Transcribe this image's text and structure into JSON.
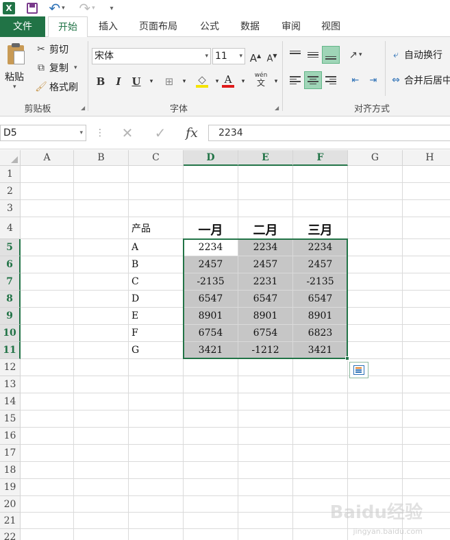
{
  "titlebar": {
    "logo": "X"
  },
  "tabs": [
    {
      "label": "文件",
      "active": false,
      "file": true
    },
    {
      "label": "开始",
      "active": true
    },
    {
      "label": "插入"
    },
    {
      "label": "页面布局"
    },
    {
      "label": "公式"
    },
    {
      "label": "数据"
    },
    {
      "label": "审阅"
    },
    {
      "label": "视图"
    }
  ],
  "ribbon": {
    "clipboard": {
      "paste_label": "粘贴",
      "cut_label": "剪切",
      "copy_label": "复制",
      "format_painter_label": "格式刷",
      "group_label": "剪贴板"
    },
    "font": {
      "font_name": "宋体",
      "font_size": "11",
      "grow_label": "A",
      "shrink_label": "A",
      "bold_label": "B",
      "italic_label": "I",
      "underline_label": "U",
      "font_color_label": "A",
      "phonetic_top": "wén",
      "phonetic_bottom": "文",
      "group_label": "字体"
    },
    "alignment": {
      "wrap_label": "自动换行",
      "merge_label": "合并后居中",
      "group_label": "对齐方式"
    },
    "colors": {
      "accent": "#217346",
      "font_color_bar": "#e01a1a",
      "fill_color_bar": "#f5e400",
      "selected_align_bg": "#9fd5b7"
    }
  },
  "formula_bar": {
    "name_box": "D5",
    "cancel_icon": "✕",
    "enter_icon": "✓",
    "fx_label": "fx",
    "value": "2234"
  },
  "sheet": {
    "columns": [
      "A",
      "B",
      "C",
      "D",
      "E",
      "F",
      "G",
      "H"
    ],
    "rows": [
      "1",
      "2",
      "3",
      "4",
      "5",
      "6",
      "7",
      "8",
      "9",
      "10",
      "11",
      "12",
      "13",
      "14",
      "15",
      "16",
      "17",
      "18",
      "19",
      "20",
      "21",
      "22"
    ],
    "header_row": {
      "c": "产品",
      "d": "一月",
      "e": "二月",
      "f": "三月"
    },
    "data": [
      {
        "product": "A",
        "d": "2234",
        "e": "2234",
        "f": "2234"
      },
      {
        "product": "B",
        "d": "2457",
        "e": "2457",
        "f": "2457"
      },
      {
        "product": "C",
        "d": "-2135",
        "e": "2231",
        "f": "-2135"
      },
      {
        "product": "D",
        "d": "6547",
        "e": "6547",
        "f": "6547"
      },
      {
        "product": "E",
        "d": "8901",
        "e": "8901",
        "f": "8901"
      },
      {
        "product": "F",
        "d": "6754",
        "e": "6754",
        "f": "6823"
      },
      {
        "product": "G",
        "d": "3421",
        "e": "-1212",
        "f": "3421"
      }
    ],
    "selected_range": "D5:F11",
    "selection_color": "#217346",
    "selection_fill": "#c6c6c6"
  },
  "watermark": {
    "brand": "Baidu经验",
    "url": "jingyan.baidu.com"
  }
}
